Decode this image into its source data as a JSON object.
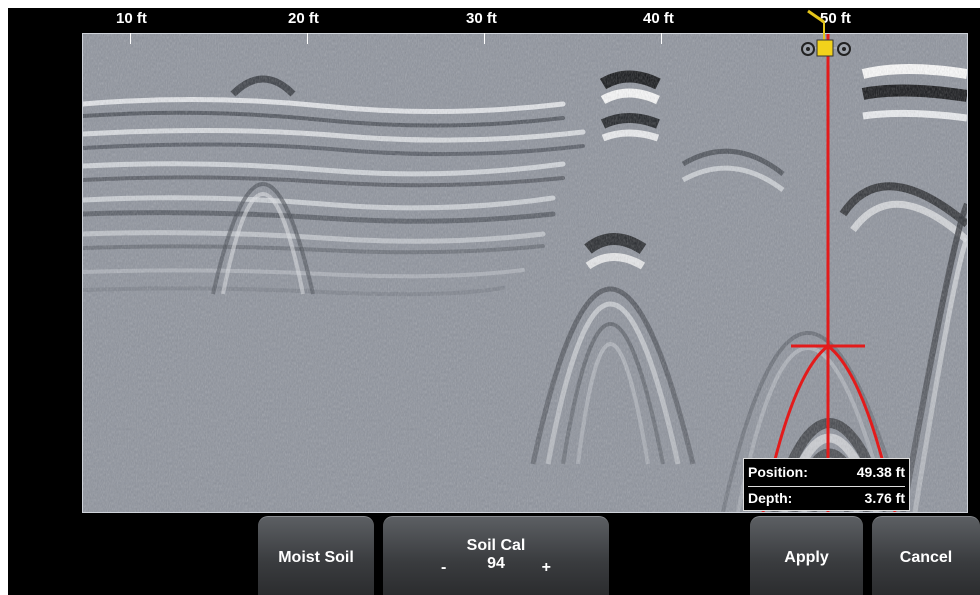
{
  "ruler": {
    "ticks": [
      {
        "label": "10 ft"
      },
      {
        "label": "20 ft"
      },
      {
        "label": "30 ft"
      },
      {
        "label": "40 ft"
      },
      {
        "label": "50 ft"
      }
    ]
  },
  "readout": {
    "position_label": "Position:",
    "position_value": "49.38 ft",
    "depth_label": "Depth:",
    "depth_value": "3.76 ft"
  },
  "buttons": {
    "moist_soil": "Moist Soil",
    "soil_cal_title": "Soil Cal",
    "soil_cal_value": "94",
    "soil_cal_minus": "-",
    "soil_cal_plus": "+",
    "apply": "Apply",
    "cancel": "Cancel"
  },
  "colors": {
    "cursor": "#e31b1b",
    "cart": "#f2d21b",
    "background": "#000000"
  }
}
